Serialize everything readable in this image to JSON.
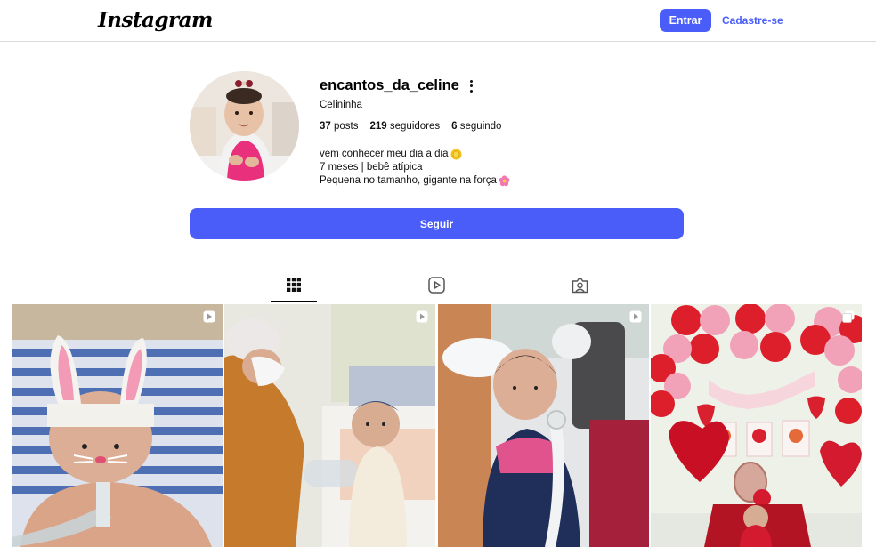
{
  "header": {
    "logo_text": "Instagram",
    "login_label": "Entrar",
    "signup_label": "Cadastre-se",
    "accent_color": "#4a5df9"
  },
  "profile": {
    "username": "encantos_da_celine",
    "full_name": "Celininha",
    "stats": {
      "posts_count": "37",
      "posts_label": "posts",
      "followers_count": "219",
      "followers_label": "seguidores",
      "following_count": "6",
      "following_label": "seguindo"
    },
    "bio": {
      "line1": "vem conhecer meu dia a dia",
      "line1_emoji": "sun-icon",
      "line2": "7 meses | bebê atípica",
      "line3": "Pequena no tamanho, gigante na força",
      "line3_emoji": "flower-icon"
    },
    "follow_label": "Seguir"
  },
  "tabs": [
    {
      "name": "posts",
      "icon": "grid-icon",
      "active": true
    },
    {
      "name": "reels",
      "icon": "reels-icon",
      "active": false
    },
    {
      "name": "tagged",
      "icon": "tagged-icon",
      "active": false
    }
  ],
  "posts": [
    {
      "type": "reel",
      "badge_icon": "reel-badge-icon",
      "subject": "baby-bunny-ears"
    },
    {
      "type": "reel",
      "badge_icon": "reel-badge-icon",
      "subject": "nurse-with-baby"
    },
    {
      "type": "reel",
      "badge_icon": "reel-badge-icon",
      "subject": "baby-with-tube"
    },
    {
      "type": "carousel",
      "badge_icon": "carousel-badge-icon",
      "subject": "strawberry-party"
    }
  ]
}
